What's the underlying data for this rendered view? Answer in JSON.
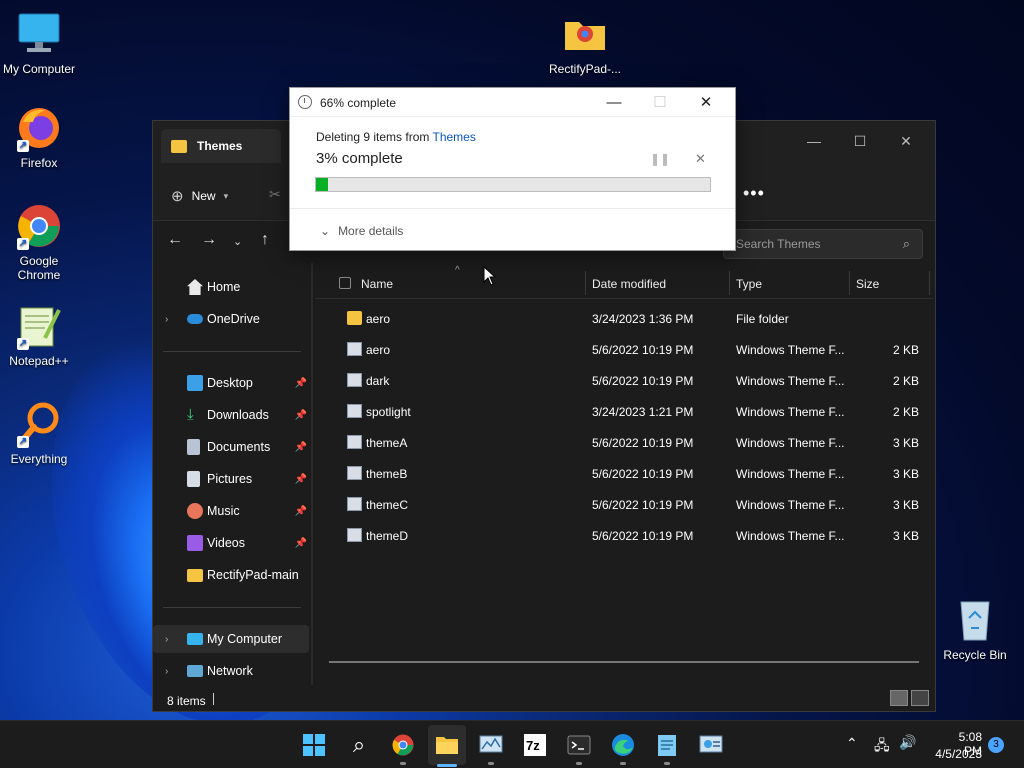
{
  "desktop": {
    "icons": [
      {
        "label": "My Computer"
      },
      {
        "label": "Firefox"
      },
      {
        "label": "Google Chrome"
      },
      {
        "label": "Notepad++"
      },
      {
        "label": "Everything"
      },
      {
        "label": "RectifyPad-..."
      },
      {
        "label": "Recycle Bin"
      }
    ]
  },
  "explorer": {
    "tab_title": "Themes",
    "new_label": "New",
    "search_placeholder": "Search Themes",
    "sidebar": {
      "home": "Home",
      "onedrive": "OneDrive",
      "desktop": "Desktop",
      "downloads": "Downloads",
      "documents": "Documents",
      "pictures": "Pictures",
      "music": "Music",
      "videos": "Videos",
      "rectifypad": "RectifyPad-main",
      "mycomputer": "My Computer",
      "network": "Network"
    },
    "columns": {
      "name": "Name",
      "date": "Date modified",
      "type": "Type",
      "size": "Size"
    },
    "files": [
      {
        "name": "aero",
        "date": "3/24/2023 1:36 PM",
        "type": "File folder",
        "size": "",
        "kind": "folder"
      },
      {
        "name": "aero",
        "date": "5/6/2022 10:19 PM",
        "type": "Windows Theme F...",
        "size": "2 KB",
        "kind": "theme"
      },
      {
        "name": "dark",
        "date": "5/6/2022 10:19 PM",
        "type": "Windows Theme F...",
        "size": "2 KB",
        "kind": "theme"
      },
      {
        "name": "spotlight",
        "date": "3/24/2023 1:21 PM",
        "type": "Windows Theme F...",
        "size": "2 KB",
        "kind": "theme"
      },
      {
        "name": "themeA",
        "date": "5/6/2022 10:19 PM",
        "type": "Windows Theme F...",
        "size": "3 KB",
        "kind": "theme"
      },
      {
        "name": "themeB",
        "date": "5/6/2022 10:19 PM",
        "type": "Windows Theme F...",
        "size": "3 KB",
        "kind": "theme"
      },
      {
        "name": "themeC",
        "date": "5/6/2022 10:19 PM",
        "type": "Windows Theme F...",
        "size": "3 KB",
        "kind": "theme"
      },
      {
        "name": "themeD",
        "date": "5/6/2022 10:19 PM",
        "type": "Windows Theme F...",
        "size": "3 KB",
        "kind": "theme"
      }
    ],
    "status_count": "8 items"
  },
  "dialog": {
    "title": "66% complete",
    "subtitle_prefix": "Deleting 9 items from ",
    "subtitle_link": "Themes",
    "progress_text": "3% complete",
    "progress_fraction": 0.03,
    "more_details": "More details",
    "accent": "#06b025"
  },
  "taskbar": {
    "time": "5:08 PM",
    "date": "4/5/2023",
    "notification_count": "3"
  }
}
